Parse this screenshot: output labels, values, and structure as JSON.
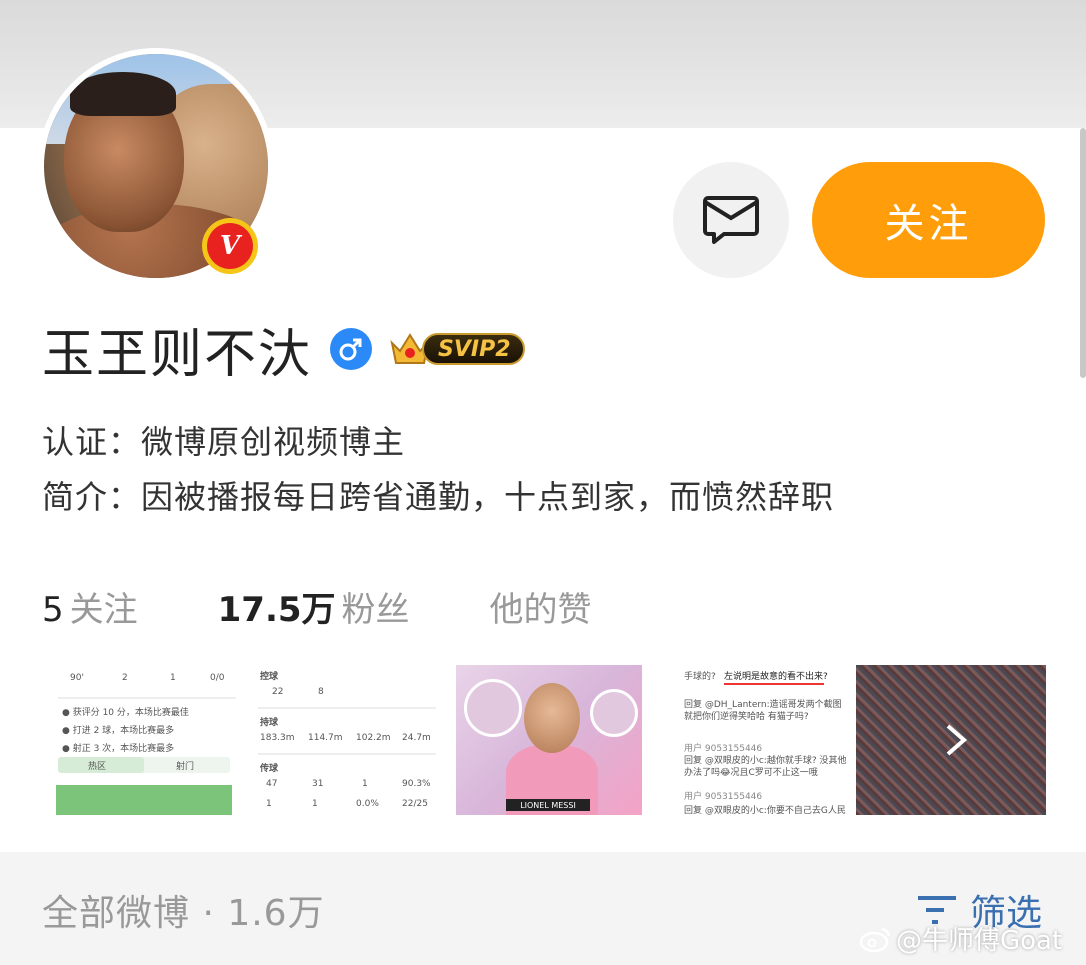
{
  "profile": {
    "name": "玉玊则不汏",
    "gender_icon": "male-symbol",
    "vip_badge": "SVIP2",
    "verified_badge": "V"
  },
  "actions": {
    "follow_label": "关注",
    "message_icon": "message-icon"
  },
  "info": {
    "verification_label": "认证：",
    "verification": "微博原创视频博主",
    "bio_label": "简介：",
    "bio": "因被播报每日跨省通勤，十点到家，而愤然辞职"
  },
  "stats": {
    "following_count": "5",
    "following_label": "关注",
    "followers_count": "17.5万",
    "followers_label": "粉丝",
    "likes_label": "他的赞"
  },
  "thumbnails": {
    "t1": {
      "rows": [
        "90'",
        "2",
        "1",
        "0/0"
      ],
      "notes": [
        "● 获评分 10 分，本场比赛最佳",
        "● 打进 2 球，本场比赛最多",
        "● 射正 3 次，本场比赛最多"
      ],
      "tabs": [
        "热区",
        "射门"
      ]
    },
    "t2": {
      "section1": "控球",
      "values1": [
        "22",
        "8"
      ],
      "section2": "持球",
      "values2": [
        "183.3m",
        "114.7m",
        "102.2m",
        "24.7m"
      ],
      "section3": "传球",
      "values3": [
        "47",
        "31",
        "1",
        "90.3%"
      ],
      "values4": [
        "1",
        "1",
        "0.0%",
        "22/25"
      ]
    },
    "t3": {
      "nameplate": "LIONEL MESSI"
    },
    "t4": {
      "line1": "手球的?",
      "highlight": "左说明是故意的看不出来?",
      "line2": "回复 @DH_Lantern:造谣哥发两个截图就把你们逆得笑哈哈 有猫子吗?",
      "user1": "用户 9053155446",
      "line3": "回复 @双眼皮的小c:越你就手球? 没其他办法了吗😂况且C罗可不止这一哦",
      "user2": "用户 9053155446",
      "line4": "回复 @双眼皮的小c:你要不自己去G人民日报报报?"
    },
    "more_icon": "chevron-right-icon"
  },
  "feed": {
    "all_weibo": "全部微博 · 1.6万",
    "filter_label": "筛选"
  },
  "watermark": "@牛师傅Goat"
}
